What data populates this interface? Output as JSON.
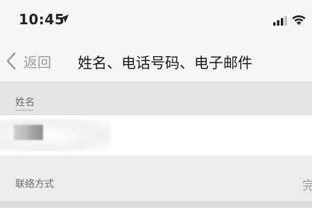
{
  "status_bar": {
    "time": "10:45",
    "location_icon": "location-arrow-icon",
    "signal_icon": "cellular-signal-icon",
    "wifi_icon": "wifi-icon"
  },
  "nav": {
    "back_label": "返回",
    "back_icon": "chevron-left-icon",
    "title": "姓名、电话号码、电子邮件"
  },
  "sections": {
    "name_label": "姓名",
    "contact_label": "联络方式",
    "contact_trailing": "完"
  },
  "colors": {
    "accent_gray": "#9a9a9a",
    "background": "#f4f4f4",
    "header_gray": "#e6e6e6"
  }
}
